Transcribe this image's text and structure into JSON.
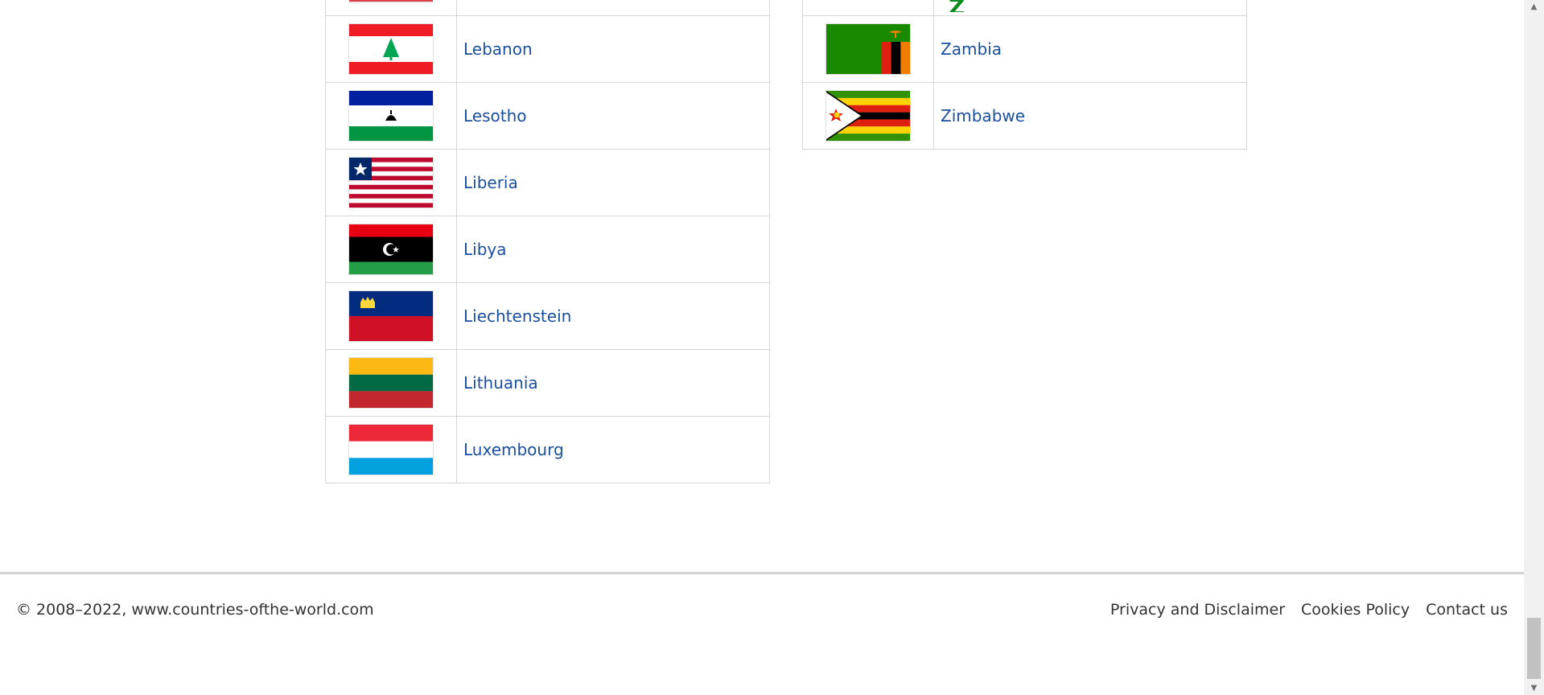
{
  "left_table": {
    "rows": [
      {
        "name": "Lebanon",
        "flag": "lebanon-flag"
      },
      {
        "name": "Lesotho",
        "flag": "lesotho-flag"
      },
      {
        "name": "Liberia",
        "flag": "liberia-flag"
      },
      {
        "name": "Libya",
        "flag": "libya-flag"
      },
      {
        "name": "Liechtenstein",
        "flag": "liechtenstein-flag"
      },
      {
        "name": "Lithuania",
        "flag": "lithuania-flag"
      },
      {
        "name": "Luxembourg",
        "flag": "luxembourg-flag"
      }
    ]
  },
  "right_table": {
    "section_letter": "Z",
    "rows": [
      {
        "name": "Zambia",
        "flag": "zambia-flag"
      },
      {
        "name": "Zimbabwe",
        "flag": "zimbabwe-flag"
      }
    ]
  },
  "footer": {
    "copyright": "© 2008–2022, www.countries-ofthe-world.com",
    "links": [
      "Privacy and Disclaimer",
      "Cookies Policy",
      "Contact us"
    ]
  },
  "colors": {
    "link": "#1a4f9c",
    "section_letter": "#0b8a1d"
  }
}
